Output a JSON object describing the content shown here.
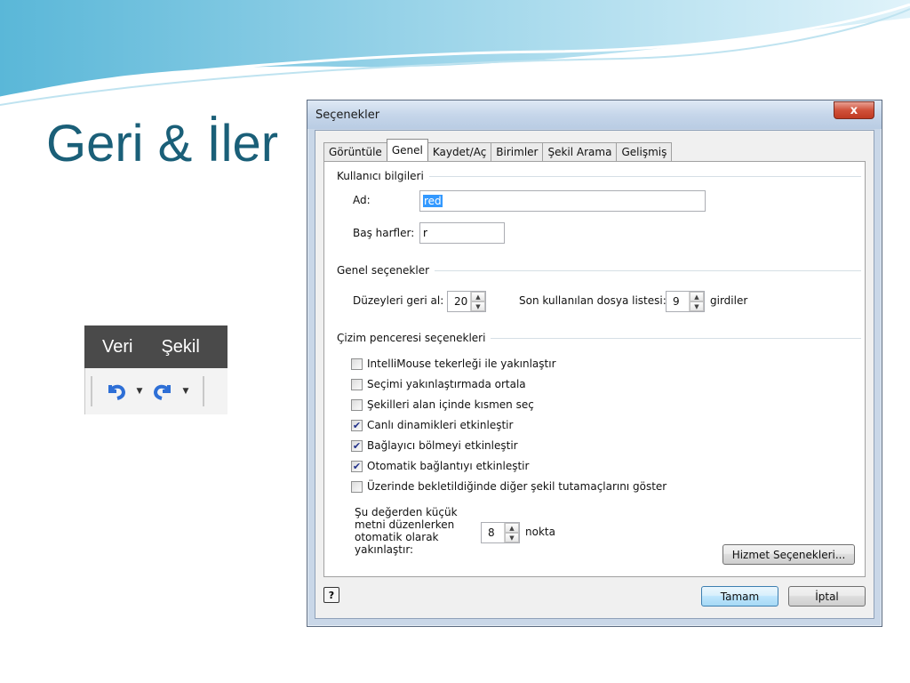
{
  "slide": {
    "title": "Geri & İler"
  },
  "toolbar_snippet": {
    "menu_veri": "Veri",
    "menu_sekil": "Şekil",
    "undo_icon": "undo-icon",
    "redo_icon": "redo-icon"
  },
  "dialog": {
    "title": "Seçenekler",
    "close_label": "x",
    "tabs": [
      {
        "label": "Görüntüle"
      },
      {
        "label": "Genel"
      },
      {
        "label": "Kaydet/Aç"
      },
      {
        "label": "Birimler"
      },
      {
        "label": "Şekil Arama"
      },
      {
        "label": "Gelişmiş"
      }
    ],
    "active_tab": "Genel",
    "user_info": {
      "heading": "Kullanıcı bilgileri",
      "name_label": "Ad:",
      "name_value": "red",
      "initials_label": "Baş harfler:",
      "initials_value": "r"
    },
    "general": {
      "heading": "Genel seçenekler",
      "undo_label": "Düzeyleri geri al:",
      "undo_value": "20",
      "recent_label": "Son kullanılan dosya listesi:",
      "recent_value": "9",
      "recent_suffix": "girdiler"
    },
    "drawing": {
      "heading": "Çizim penceresi seçenekleri",
      "checkboxes": [
        {
          "label": "IntelliMouse tekerleği ile yakınlaştır",
          "checked": false
        },
        {
          "label": "Seçimi yakınlaştırmada ortala",
          "checked": false
        },
        {
          "label": "Şekilleri alan içinde kısmen seç",
          "checked": false
        },
        {
          "label": "Canlı dinamikleri etkinleştir",
          "checked": true
        },
        {
          "label": "Bağlayıcı bölmeyi etkinleştir",
          "checked": true
        },
        {
          "label": "Otomatik bağlantıyı etkinleştir",
          "checked": true
        },
        {
          "label": "Üzerinde bekletildiğinde diğer şekil tutamaçlarını göster",
          "checked": false
        }
      ],
      "zoom_text_lines": [
        "Şu değerden küçük",
        "metni düzenlerken",
        "otomatik olarak",
        "yakınlaştır:"
      ],
      "zoom_value": "8",
      "zoom_unit": "nokta"
    },
    "service_options_button": "Hizmet Seçenekleri...",
    "ok_button": "Tamam",
    "cancel_button": "İptal",
    "help_icon": "help-icon"
  },
  "colors": {
    "title_color": "#1a5f78",
    "checkmark": "#21318a",
    "selection": "#3399ff"
  }
}
